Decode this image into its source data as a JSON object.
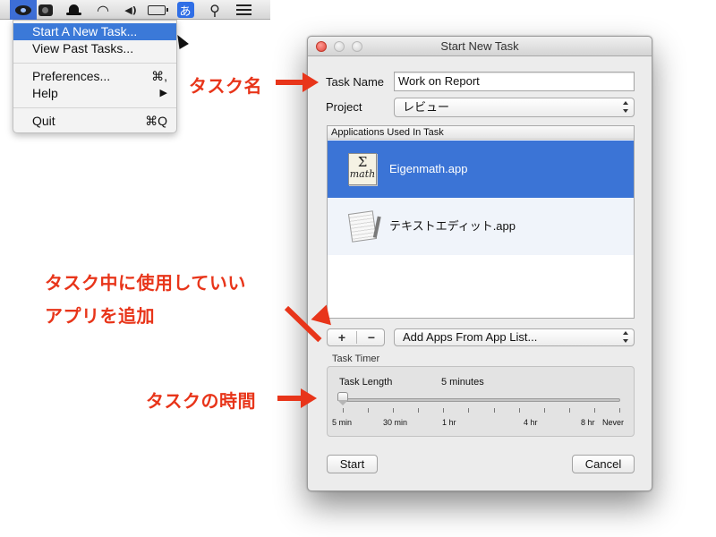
{
  "menubar": {
    "icons": [
      "eye-icon",
      "camera-icon",
      "hat-icon",
      "wifi-icon",
      "volume-icon",
      "battery-icon",
      "input-method-icon",
      "search-icon",
      "list-icon"
    ],
    "wifi_glyph": "◠",
    "volume_glyph": "◀)",
    "input_method_char": "あ",
    "search_glyph": "⚲"
  },
  "menu": {
    "items": [
      {
        "label": "Start A New Task...",
        "shortcut": "",
        "highlighted": true
      },
      {
        "label": "View Past Tasks...",
        "shortcut": ""
      },
      {
        "label": "Preferences...",
        "shortcut": "⌘,"
      },
      {
        "label": "Help",
        "shortcut": "▶"
      },
      {
        "label": "Quit",
        "shortcut": "⌘Q"
      }
    ]
  },
  "window": {
    "title": "Start New Task",
    "task_name_label": "Task Name",
    "task_name_value": "Work on Report",
    "project_label": "Project",
    "project_value": "レビュー",
    "apps_header": "Applications Used In Task",
    "apps": [
      {
        "name": "Eigenmath.app",
        "icon": "eigenmath-icon",
        "icon_symbol": "Σ",
        "icon_text": "math",
        "selected": true
      },
      {
        "name": "テキストエディット.app",
        "icon": "textedit-icon",
        "selected": false
      }
    ],
    "add_symbol": "+",
    "remove_symbol": "−",
    "add_apps_label": "Add Apps From App List...",
    "timer_label": "Task Timer",
    "task_length_label": "Task Length",
    "task_length_value": "5 minutes",
    "slider": {
      "labels": [
        "5 min",
        "30 min",
        "1 hr",
        "4 hr",
        "8 hr",
        "Never"
      ],
      "value_fraction": 0.0
    },
    "start_label": "Start",
    "cancel_label": "Cancel"
  },
  "annotations": {
    "task_name": "タスク名",
    "apps_line1": "タスク中に使用していい",
    "apps_line2": "アプリを追加",
    "timer": "タスクの時間",
    "color": "#e8351a"
  }
}
